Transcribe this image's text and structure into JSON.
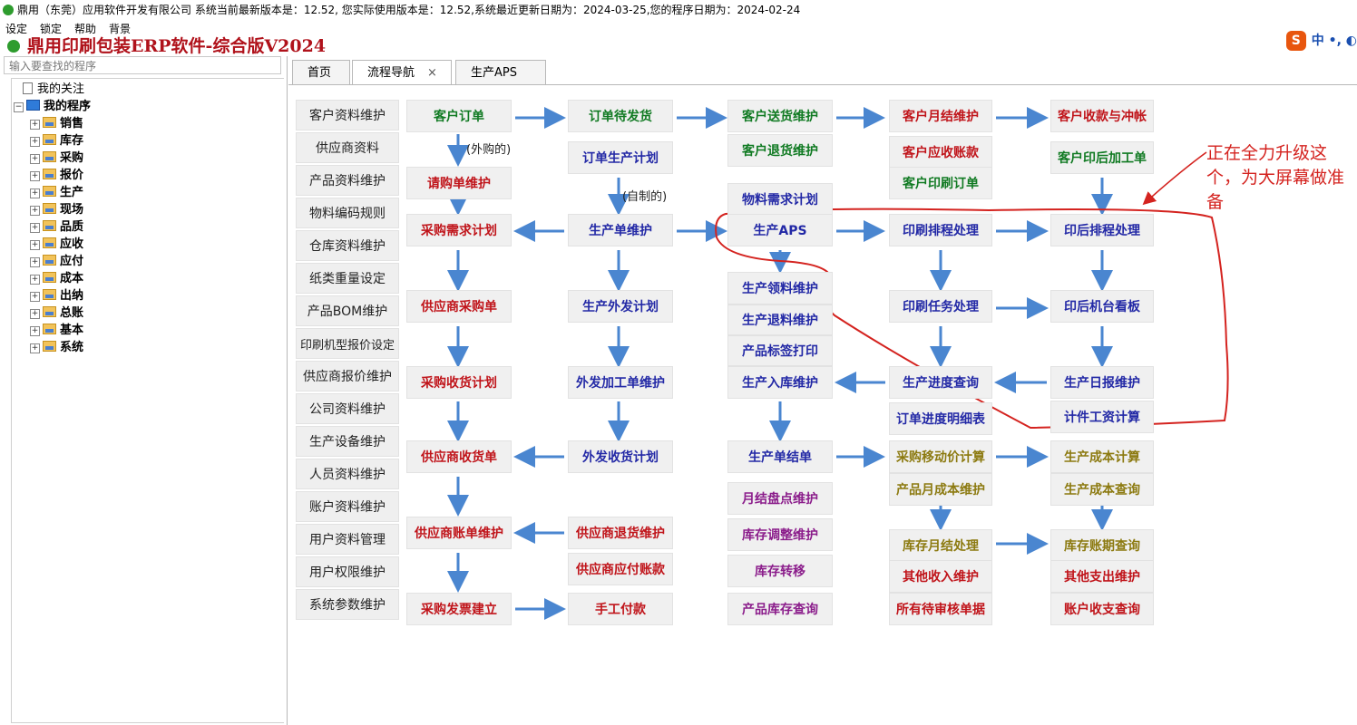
{
  "window": {
    "title": "鼎用（东莞）应用软件开发有限公司 系统当前最新版本是：12.52, 您实际使用版本是：12.52,系统最近更新日期为：2024-03-25,您的程序日期为：2024-02-24"
  },
  "menu": [
    "设定",
    "锁定",
    "帮助",
    "背景"
  ],
  "banner": {
    "title": "鼎用印刷包装ERP软件-综合版V2024"
  },
  "ime": {
    "label": "中 •, ◐"
  },
  "sidebar": {
    "search_placeholder": "输入要查找的程序",
    "favorites": "我的关注",
    "root": "我的程序",
    "items": [
      "销售",
      "库存",
      "采购",
      "报价",
      "生产",
      "现场",
      "品质",
      "应收",
      "应付",
      "成本",
      "出纳",
      "总账",
      "基本",
      "系统"
    ]
  },
  "tabs": [
    {
      "label": "首页"
    },
    {
      "label": "流程导航",
      "close": "×"
    },
    {
      "label": "生产APS"
    }
  ],
  "col0": [
    "客户资料维护",
    "供应商资料",
    "产品资料维护",
    "物料编码规则",
    "仓库资料维护",
    "纸类重量设定",
    "产品BOM维护",
    "印刷机型报价设定",
    "供应商报价维护",
    "公司资料维护",
    "生产设备维护",
    "人员资料维护",
    "账户资料维护",
    "用户资料管理",
    "用户权限维护",
    "系统参数维护"
  ],
  "col1": [
    "客户订单",
    "请购单维护",
    "采购需求计划",
    "供应商采购单",
    "采购收货计划",
    "供应商收货单",
    "供应商账单维护",
    "采购发票建立"
  ],
  "col2": [
    "订单待发货",
    "订单生产计划",
    "生产单维护",
    "生产外发计划",
    "外发加工单维护",
    "外发收货计划",
    "供应商退货维护",
    "供应商应付账款",
    "手工付款"
  ],
  "col3": [
    "客户送货维护",
    "客户退货维护",
    "物料需求计划",
    "生产APS",
    "生产领料维护",
    "生产退料维护",
    "产品标签打印",
    "生产入库维护",
    "生产单结单",
    "月结盘点维护",
    "库存调整维护",
    "库存转移",
    "产品库存查询"
  ],
  "col4": [
    "客户月结维护",
    "客户应收账款",
    "客户印刷订单",
    "印刷排程处理",
    "印刷任务处理",
    "生产进度查询",
    "订单进度明细表",
    "采购移动价计算",
    "产品月成本维护",
    "库存月结处理",
    "其他收入维护",
    "所有待审核单据"
  ],
  "col5": [
    "客户收款与冲帐",
    "客户印后加工单",
    "印后排程处理",
    "印后机台看板",
    "生产日报维护",
    "计件工资计算",
    "生产成本计算",
    "生产成本查询",
    "库存账期查询",
    "其他支出维护",
    "账户收支查询"
  ],
  "labels": {
    "outsourced": "(外购的)",
    "selfmade": "(自制的)"
  },
  "annotation": "正在全力升级这个，为大屏幕做准备",
  "colors": {
    "title_red": "#b0121b",
    "arrow_blue": "#4a86d0",
    "annot_red": "#d4231f"
  }
}
